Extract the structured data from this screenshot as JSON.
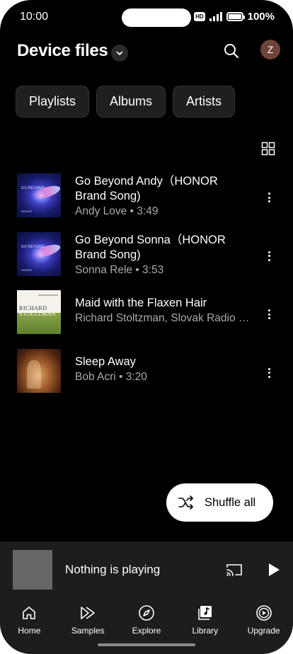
{
  "status_bar": {
    "time": "10:00",
    "hd": "HD",
    "battery": "100%"
  },
  "header": {
    "title": "Device files",
    "avatar_initial": "Z"
  },
  "chips": [
    {
      "label": "Playlists"
    },
    {
      "label": "Albums"
    },
    {
      "label": "Artists"
    }
  ],
  "songs": [
    {
      "title": "Go Beyond Andy（HONOR Brand Song)",
      "subtitle": "Andy Love • 3:49",
      "art_text": "GO BEYOND",
      "art_brand": "HONOR"
    },
    {
      "title": "Go Beyond Sonna（HONOR Brand Song)",
      "subtitle": "Sonna Rele • 3:53",
      "art_text": "GO BEYOND",
      "art_brand": "HONOR"
    },
    {
      "title": "Maid with the Flaxen Hair",
      "subtitle": "Richard Stoltzman, Slovak Radio Symphony Orchestra",
      "art_text_1": "RICHARD",
      "art_text_2": "STOLTZMAN"
    },
    {
      "title": "Sleep Away",
      "subtitle": "Bob Acri • 3:20"
    }
  ],
  "shuffle": {
    "label": "Shuffle all"
  },
  "mini_player": {
    "text": "Nothing is playing"
  },
  "nav": [
    {
      "label": "Home",
      "icon": "home-icon"
    },
    {
      "label": "Samples",
      "icon": "samples-icon"
    },
    {
      "label": "Explore",
      "icon": "compass-icon"
    },
    {
      "label": "Library",
      "icon": "library-icon"
    },
    {
      "label": "Upgrade",
      "icon": "upgrade-icon"
    }
  ],
  "colors": {
    "background": "#000000",
    "surface": "#1d1d1d",
    "chip": "#1f1f1f",
    "subtext": "#aaaaaa",
    "avatar": "#6d4439"
  }
}
